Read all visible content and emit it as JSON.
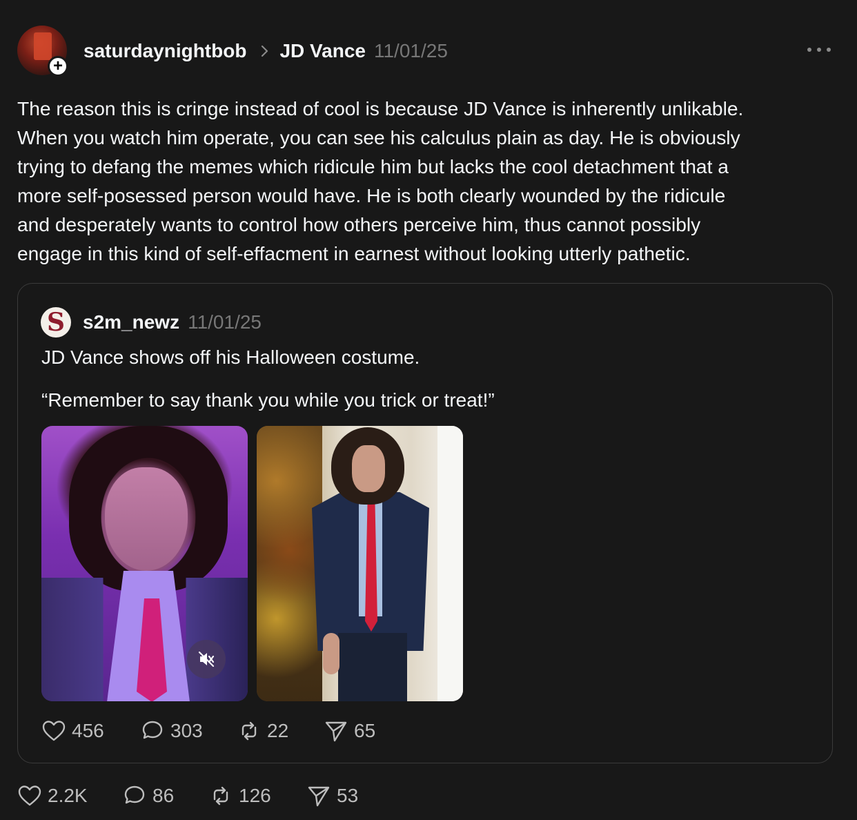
{
  "post": {
    "author": "saturdaynightbob",
    "topic": "JD Vance",
    "date": "11/01/25",
    "text": "The reason this is cringe instead of cool is because JD Vance is inherently unlikable.\nWhen you watch him operate, you can see his calculus plain as day. He is obviously\ntrying to defang the memes which ridicule him but lacks the cool detachment that a\nmore self-posessed person would have. He is both clearly wounded by the ridicule\nand desperately wants to control how others perceive him, thus cannot possibly\nengage in this kind of self-effacment in earnest without looking utterly pathetic.",
    "stats": {
      "likes": "2.2K",
      "replies": "86",
      "reposts": "126",
      "shares": "53"
    }
  },
  "quoted": {
    "avatar_letter": "S",
    "author": "s2m_newz",
    "date": "11/01/25",
    "line1": "JD Vance shows off his Halloween costume.",
    "line2": "“Remember to say thank you while you trick or treat!”",
    "stats": {
      "likes": "456",
      "replies": "303",
      "reposts": "22",
      "shares": "65"
    }
  },
  "icons": {
    "follow": "plus-icon",
    "header_separator": "chevron-right-icon",
    "more": "more-horizontal-icon",
    "like": "heart-icon",
    "reply": "comment-icon",
    "repost": "repost-icon",
    "share": "send-icon",
    "mute": "muted-speaker-icon"
  },
  "colors": {
    "background": "#181818",
    "text": "#f3f5f7",
    "muted": "#777777",
    "border": "#3b3b3b"
  }
}
